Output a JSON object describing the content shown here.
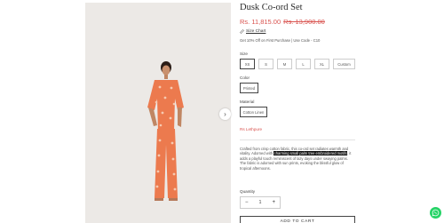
{
  "product": {
    "title": "Dusk Co-ord Set",
    "price_sale": "Rs. 11,815.00",
    "price_original": "Rs. 13,900.00",
    "size_chart_label": "Size Chart",
    "offer_text": "Get 10% Off on First Purchase | Use Code - C10",
    "size_label": "Size",
    "sizes": [
      "XS",
      "S",
      "M",
      "L",
      "XL",
      "Custom"
    ],
    "selected_size": "XS",
    "color_label": "Color",
    "colors": [
      "Printed"
    ],
    "material_label": "Material",
    "materials": [
      "Cotton Linen"
    ],
    "collapse_link": "Rs Lethpure",
    "description_before": "Crafted from crisp cotton fabric, this co-ord set radiates warmth and vitality. Adorned with ",
    "description_highlight": "charming small palm tree embroidered motifs",
    "description_after": ", it adds a playful touch reminiscent of lazy days under swaying palms. The fabric is adorned with sun prints, evoking the blissful glow of tropical afternoons.",
    "quantity_label": "Quantity",
    "quantity_value": "1",
    "minus_label": "−",
    "plus_label": "+",
    "add_to_cart_label": "ADD TO CART"
  },
  "gallery": {
    "next_arrow": "›"
  },
  "colors": {
    "sale": "#d9534f",
    "outfit": "#ec7a4e",
    "whatsapp": "#25d366"
  },
  "icons": {
    "ruler": "ruler-icon",
    "next": "chevron-right-icon",
    "whatsapp": "whatsapp-icon"
  }
}
